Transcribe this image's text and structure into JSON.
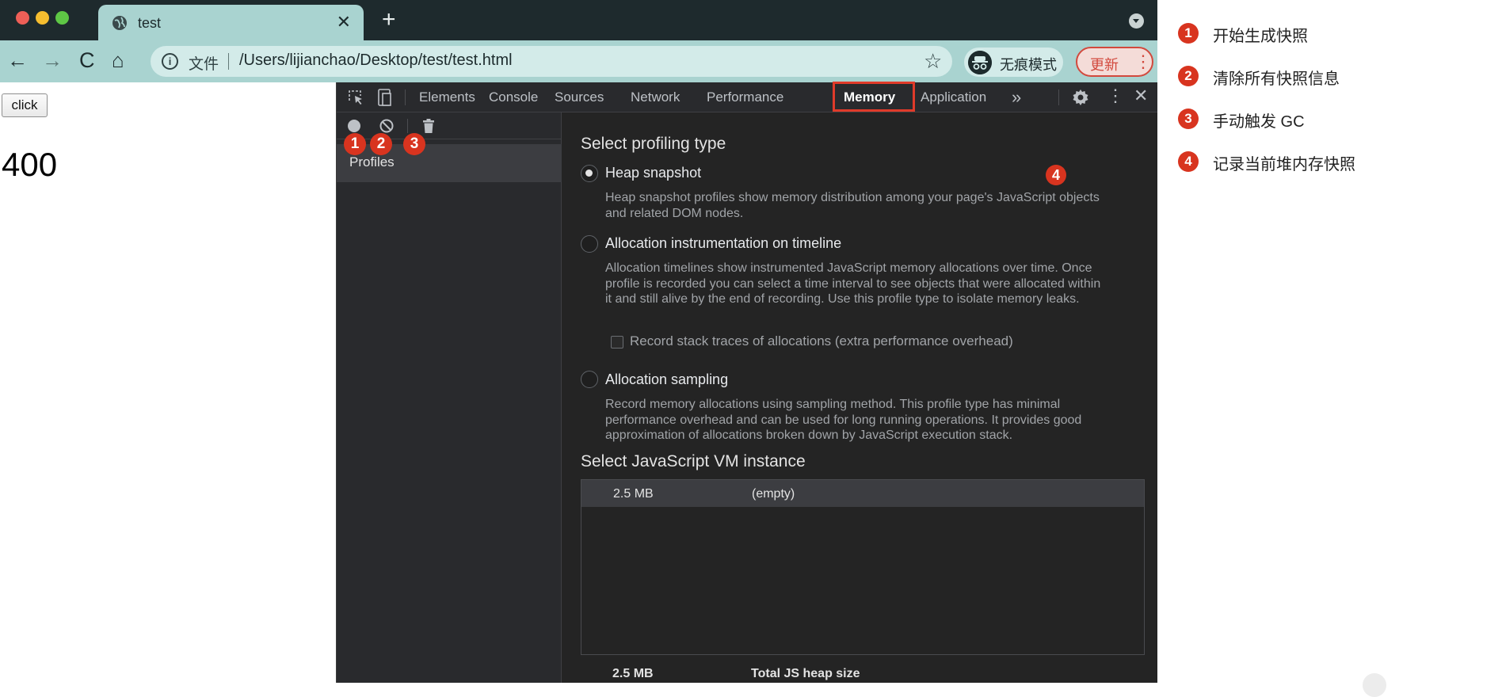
{
  "browser": {
    "tab_title": "test",
    "tab_close": "✕",
    "new_tab": "+",
    "nav": {
      "back": "←",
      "forward": "→",
      "reload": "C",
      "home": "⌂"
    },
    "omnibox": {
      "info_icon": "i",
      "scheme_label": "文件",
      "url": "/Users/lijianchao/Desktop/test/test.html",
      "star": "☆"
    },
    "incognito_label": "无痕模式",
    "update_label": "更新",
    "update_menu": "⋮"
  },
  "page": {
    "button_label": "click",
    "counter": "400"
  },
  "devtools": {
    "tabs": [
      "Elements",
      "Console",
      "Sources",
      "Network",
      "Performance",
      "Memory",
      "Application"
    ],
    "active_tab": "Memory",
    "more_tabs": "»",
    "kebab": "⋮",
    "close": "✕",
    "sidebar": {
      "profiles_label": "Profiles"
    },
    "main": {
      "profiling_title": "Select profiling type",
      "options": [
        {
          "label": "Heap snapshot",
          "description_lines": [
            "Heap snapshot profiles show memory distribution among your page's JavaScript objects",
            "and related DOM nodes."
          ],
          "checked": true
        },
        {
          "label": "Allocation instrumentation on timeline",
          "description_lines": [
            "Allocation timelines show instrumented JavaScript memory allocations over time. Once",
            "profile is recorded you can select a time interval to see objects that were allocated within",
            "it and still alive by the end of recording. Use this profile type to isolate memory leaks."
          ],
          "checked": false
        },
        {
          "label": "Allocation sampling",
          "description_lines": [
            "Record memory allocations using sampling method. This profile type has minimal",
            "performance overhead and can be used for long running operations. It provides good",
            "approximation of allocations broken down by JavaScript execution stack."
          ],
          "checked": false
        }
      ],
      "stack_traces_label": "Record stack traces of allocations (extra performance overhead)",
      "vm_title": "Select JavaScript VM instance",
      "vm_row": {
        "size": "2.5 MB",
        "name": "(empty)"
      },
      "total": {
        "size": "2.5 MB",
        "label": "Total JS heap size"
      }
    }
  },
  "annotations": {
    "badges": [
      "1",
      "2",
      "3",
      "4"
    ],
    "highlight_color": "#e03b2a",
    "legend": [
      {
        "num": "1",
        "text": "开始生成快照"
      },
      {
        "num": "2",
        "text": "清除所有快照信息"
      },
      {
        "num": "3",
        "text": "手动触发 GC"
      },
      {
        "num": "4",
        "text": "记录当前堆内存快照"
      }
    ]
  },
  "colors": {
    "tabstrip": "#1e2a2d",
    "toolbar": "#a9d3d0",
    "devtools_bg": "#242424",
    "badge": "#d8341f"
  }
}
